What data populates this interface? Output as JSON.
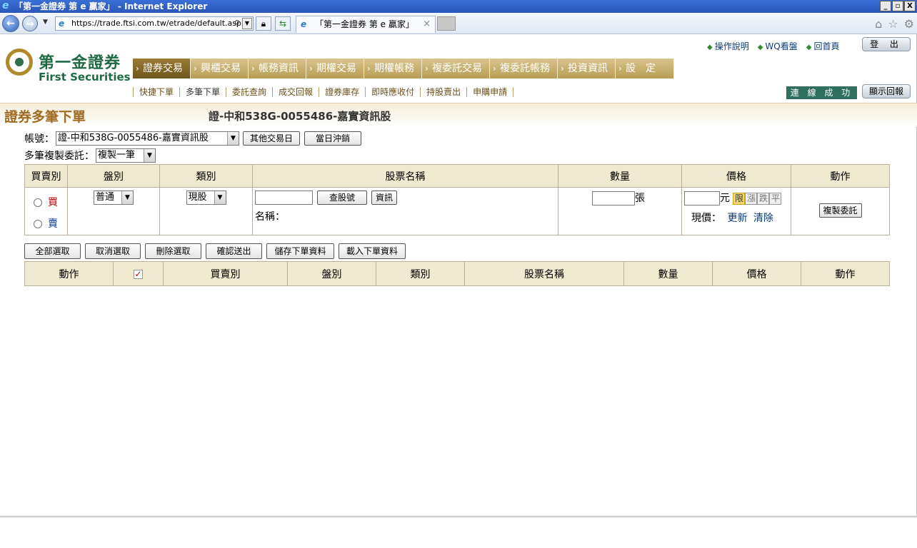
{
  "window": {
    "title": "「第一金證券 第 e 贏家」 - Internet Explorer",
    "controls": [
      "_",
      "▫",
      "X"
    ]
  },
  "browser": {
    "url": "https://trade.ftsi.com.tw/etrade/default.aspx",
    "tab_title": "「第一金證券 第 e 贏家」",
    "tab_close": "×"
  },
  "brand": {
    "name_zh": "第一金證券",
    "name_en": "First Securities",
    "accent_color": "#1f6a44",
    "gold_color": "#b89d54"
  },
  "top_links": [
    "操作說明",
    "WQ看盤",
    "回首頁"
  ],
  "logout_label": "登 出",
  "main_menu": [
    "證券交易",
    "興櫃交易",
    "帳務資訊",
    "期權交易",
    "期權帳務",
    "複委託交易",
    "複委託帳務",
    "投資資訊",
    "設　定"
  ],
  "sub_menu": [
    "快捷下單",
    "多筆下單",
    "委託查詢",
    "成交回報",
    "證券庫存",
    "即時應收付",
    "持股賣出",
    "申購申請"
  ],
  "connection_status": "連 線 成 功",
  "show_report_label": "顯示回報",
  "page": {
    "title": "證券多筆下單",
    "account_title": "證-中和538G-0055486-嘉實資訊股"
  },
  "form": {
    "account_label": "帳號：",
    "account_value": "證-中和538G-0055486-嘉實資訊股",
    "other_day_button": "其他交易日",
    "day_cancel_button": "當日沖銷",
    "copy_label": "多筆複製委託：",
    "copy_value": "複製一筆"
  },
  "order_table": {
    "headers": [
      "買賣別",
      "盤別",
      "類別",
      "股票名稱",
      "數量",
      "價格",
      "動作"
    ],
    "buy_label": "買",
    "sell_label": "賣",
    "session_value": "普通",
    "type_value": "現股",
    "lookup_button": "查股號",
    "info_button": "資訊",
    "name_label": "名稱：",
    "qty_unit": "張",
    "price_unit": "元",
    "price_buttons": [
      "限",
      "漲",
      "跌",
      "平"
    ],
    "current_price_label": "現價：",
    "refresh_link": "更新",
    "clear_link": "清除",
    "copy_order_button": "複製委託"
  },
  "action_buttons": [
    "全部選取",
    "取消選取",
    "刪除選取",
    "確認送出",
    "儲存下單資料",
    "載入下單資料"
  ],
  "list_table": {
    "headers": [
      "動作",
      "✓",
      "買賣別",
      "盤別",
      "類別",
      "股票名稱",
      "數量",
      "價格",
      "動作"
    ]
  }
}
